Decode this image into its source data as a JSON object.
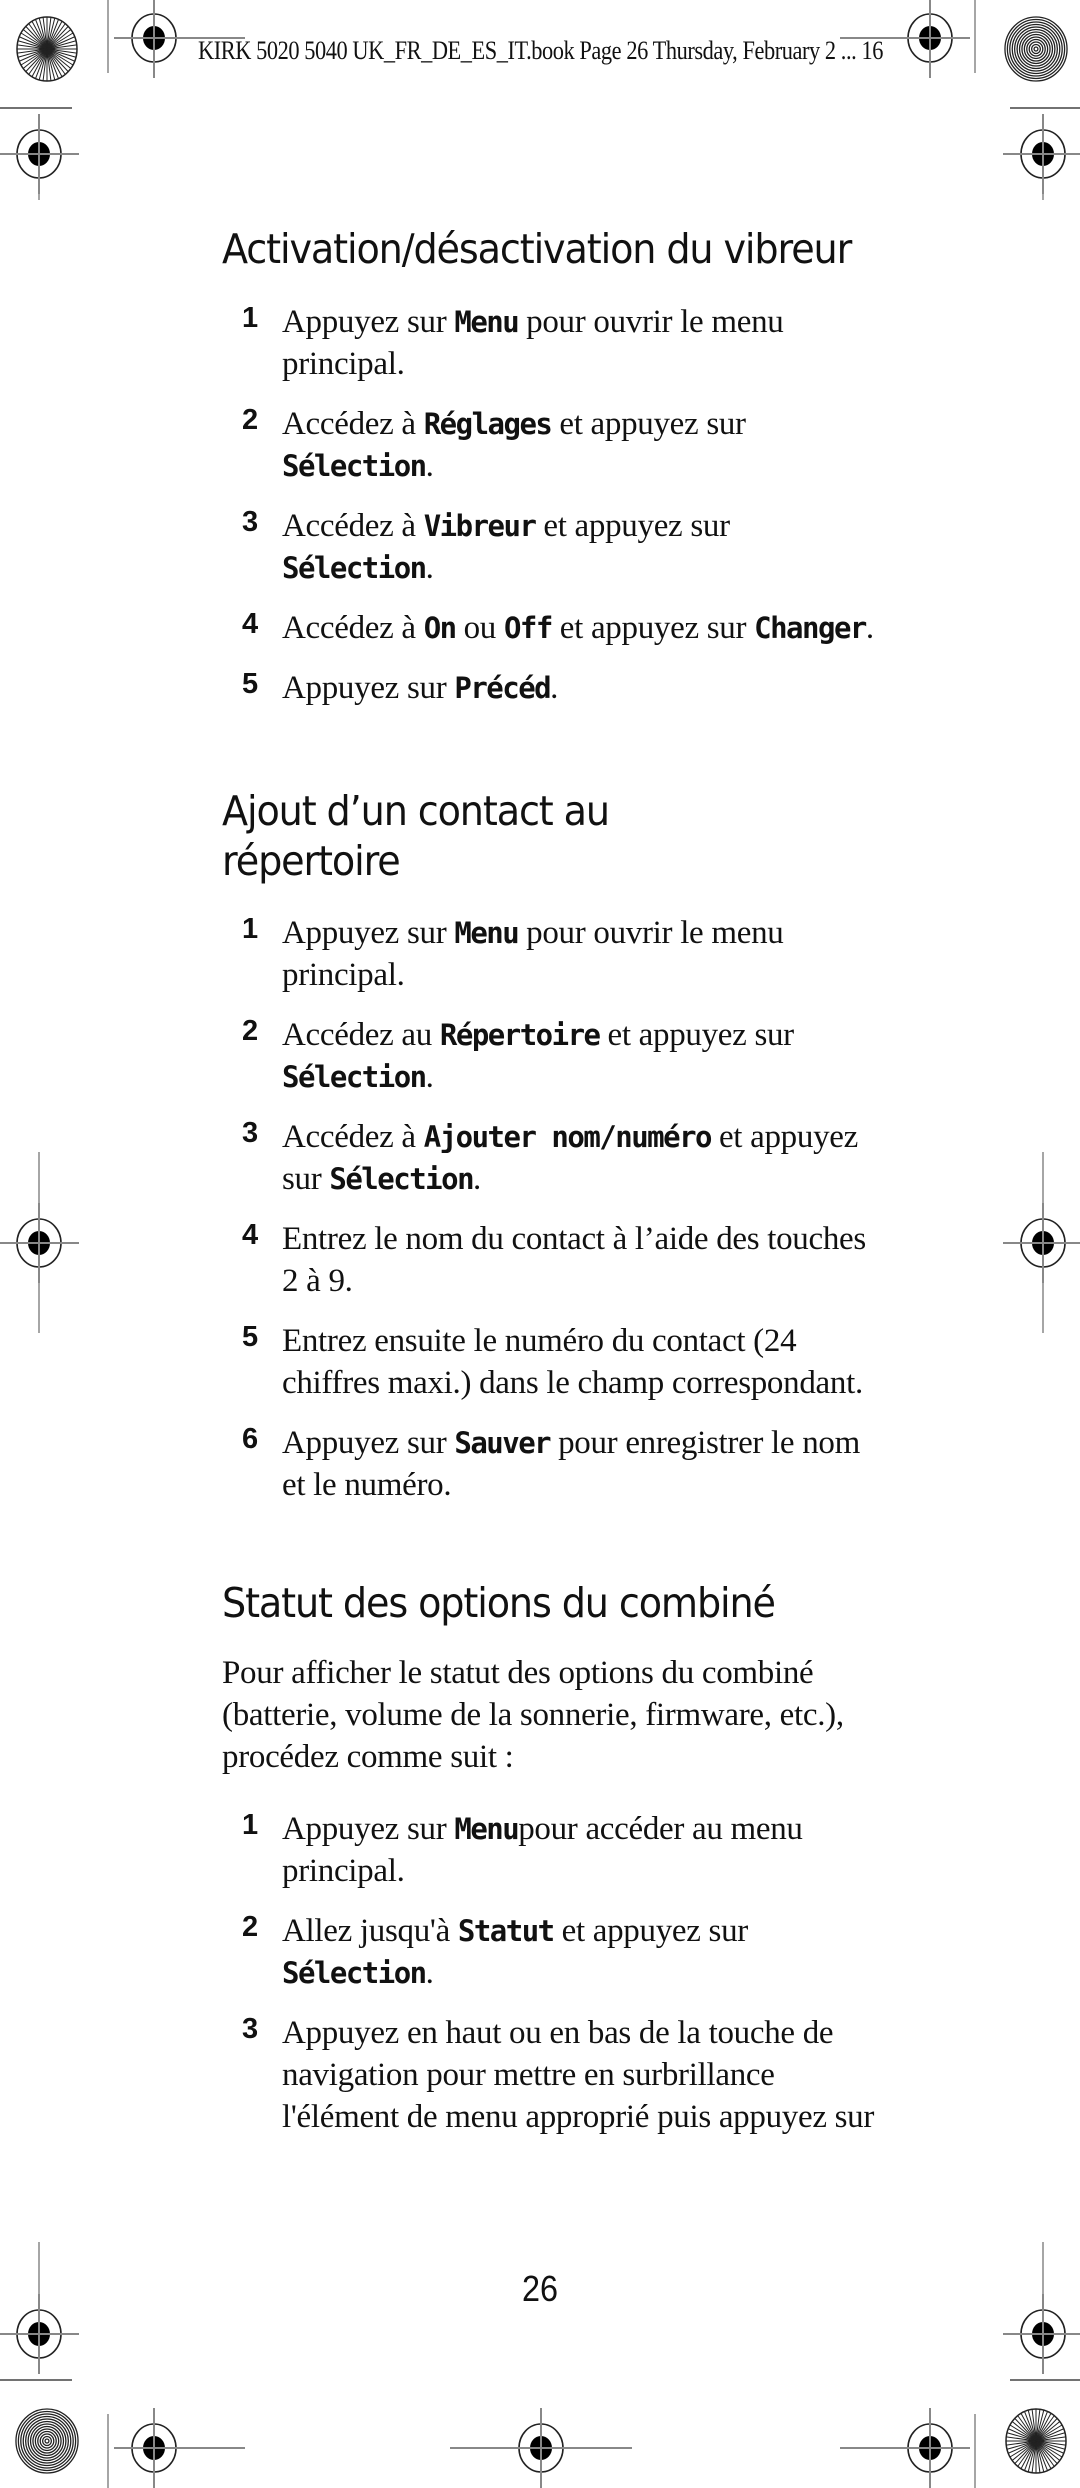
{
  "header": {
    "slug": "KIRK 5020 5040 UK_FR_DE_ES_IT.book  Page 26  Thursday, February 2 ... 16"
  },
  "sections": [
    {
      "title": "Activation/désactivation du vibreur",
      "steps": [
        {
          "num": "1",
          "parts": [
            [
              "t",
              "Appuyez sur "
            ],
            [
              "k",
              "Menu"
            ],
            [
              "t",
              " pour ouvrir le menu principal."
            ]
          ]
        },
        {
          "num": "2",
          "parts": [
            [
              "t",
              "Accédez à "
            ],
            [
              "k",
              "Réglages"
            ],
            [
              "t",
              " et appuyez sur "
            ],
            [
              "k",
              "Sélection"
            ],
            [
              "t",
              "."
            ]
          ]
        },
        {
          "num": "3",
          "parts": [
            [
              "t",
              "Accédez à "
            ],
            [
              "k",
              "Vibreur"
            ],
            [
              "t",
              " et appuyez sur "
            ],
            [
              "k",
              "Sélection"
            ],
            [
              "t",
              "."
            ]
          ]
        },
        {
          "num": "4",
          "parts": [
            [
              "t",
              "Accédez à "
            ],
            [
              "k",
              "On"
            ],
            [
              "t",
              " ou "
            ],
            [
              "k",
              "Off"
            ],
            [
              "t",
              " et appuyez sur "
            ],
            [
              "k",
              "Changer"
            ],
            [
              "t",
              "."
            ]
          ]
        },
        {
          "num": "5",
          "parts": [
            [
              "t",
              "Appuyez sur "
            ],
            [
              "k",
              "Précéd"
            ],
            [
              "t",
              "."
            ]
          ]
        }
      ]
    },
    {
      "title_lines": [
        "Ajout d’un contact au",
        "répertoire"
      ],
      "steps": [
        {
          "num": "1",
          "parts": [
            [
              "t",
              "Appuyez sur "
            ],
            [
              "k",
              "Menu"
            ],
            [
              "t",
              " pour ouvrir le menu principal."
            ]
          ]
        },
        {
          "num": "2",
          "parts": [
            [
              "t",
              "Accédez au "
            ],
            [
              "k",
              "Répertoire"
            ],
            [
              "t",
              " et appuyez sur "
            ],
            [
              "k",
              "Sélection"
            ],
            [
              "t",
              "."
            ]
          ]
        },
        {
          "num": "3",
          "parts": [
            [
              "t",
              "Accédez à "
            ],
            [
              "k",
              "Ajouter nom/numéro"
            ],
            [
              "t",
              " et appuyez sur "
            ],
            [
              "k",
              "Sélection"
            ],
            [
              "t",
              "."
            ]
          ]
        },
        {
          "num": "4",
          "parts": [
            [
              "t",
              "Entrez le nom du contact à l’aide des touches 2 à 9."
            ]
          ]
        },
        {
          "num": "5",
          "parts": [
            [
              "t",
              "Entrez ensuite le numéro du contact (24 chiffres maxi.) dans le champ correspondant."
            ]
          ]
        },
        {
          "num": "6",
          "parts": [
            [
              "t",
              "Appuyez sur "
            ],
            [
              "k",
              "Sauver"
            ],
            [
              "t",
              " pour enregistrer le nom et le numéro."
            ]
          ]
        }
      ]
    },
    {
      "title": "Statut des options du combiné",
      "intro": "Pour afficher le statut des options du combiné (batterie, volume de la sonnerie, firmware, etc.), procédez comme suit :",
      "steps": [
        {
          "num": "1",
          "parts": [
            [
              "t",
              "Appuyez sur "
            ],
            [
              "k",
              "Menu"
            ],
            [
              "t",
              "pour accéder au menu principal."
            ]
          ]
        },
        {
          "num": "2",
          "parts": [
            [
              "t",
              "Allez jusqu'à "
            ],
            [
              "k",
              "Statut"
            ],
            [
              "t",
              " et appuyez sur "
            ],
            [
              "k",
              "Sélection"
            ],
            [
              "t",
              "."
            ]
          ]
        },
        {
          "num": "3",
          "parts": [
            [
              "t",
              "Appuyez en haut ou en bas de la touche de navigation pour mettre en surbrillance l'élément de menu approprié puis appuyez sur"
            ]
          ]
        }
      ]
    }
  ],
  "footer": {
    "page_number": "26"
  },
  "icons": {
    "registration": "crosshair-target-icon",
    "starburst": "starburst-calibration-icon",
    "concentric": "concentric-rings-icon"
  }
}
